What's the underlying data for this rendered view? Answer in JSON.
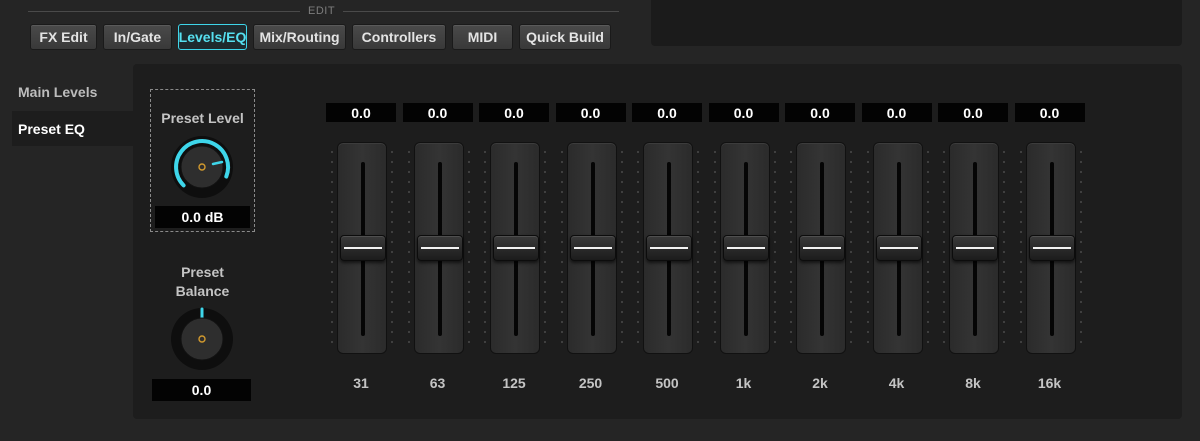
{
  "edit_label": "EDIT",
  "tabs": [
    {
      "label": "FX Edit",
      "active": false
    },
    {
      "label": "In/Gate",
      "active": false
    },
    {
      "label": "Levels/EQ",
      "active": true
    },
    {
      "label": "Mix/Routing",
      "active": false
    },
    {
      "label": "Controllers",
      "active": false
    },
    {
      "label": "MIDI",
      "active": false
    },
    {
      "label": "Quick Build",
      "active": false
    }
  ],
  "sidebar": {
    "items": [
      {
        "label": "Main Levels",
        "selected": false
      },
      {
        "label": "Preset EQ",
        "selected": true
      }
    ]
  },
  "preset_level": {
    "label": "Preset Level",
    "value": "0.0 dB"
  },
  "preset_balance": {
    "label_line1": "Preset",
    "label_line2": "Balance",
    "value": "0.0"
  },
  "eq_bands": [
    {
      "freq": "31",
      "value": "0.0"
    },
    {
      "freq": "63",
      "value": "0.0"
    },
    {
      "freq": "125",
      "value": "0.0"
    },
    {
      "freq": "250",
      "value": "0.0"
    },
    {
      "freq": "500",
      "value": "0.0"
    },
    {
      "freq": "1k",
      "value": "0.0"
    },
    {
      "freq": "2k",
      "value": "0.0"
    },
    {
      "freq": "4k",
      "value": "0.0"
    },
    {
      "freq": "8k",
      "value": "0.0"
    },
    {
      "freq": "16k",
      "value": "0.0"
    }
  ],
  "colors": {
    "accent": "#3ed6ea",
    "knob_center": "#d29a2e"
  },
  "icons": {
    "level_knob": "rotary-knob-icon",
    "balance_knob": "rotary-knob-icon"
  }
}
